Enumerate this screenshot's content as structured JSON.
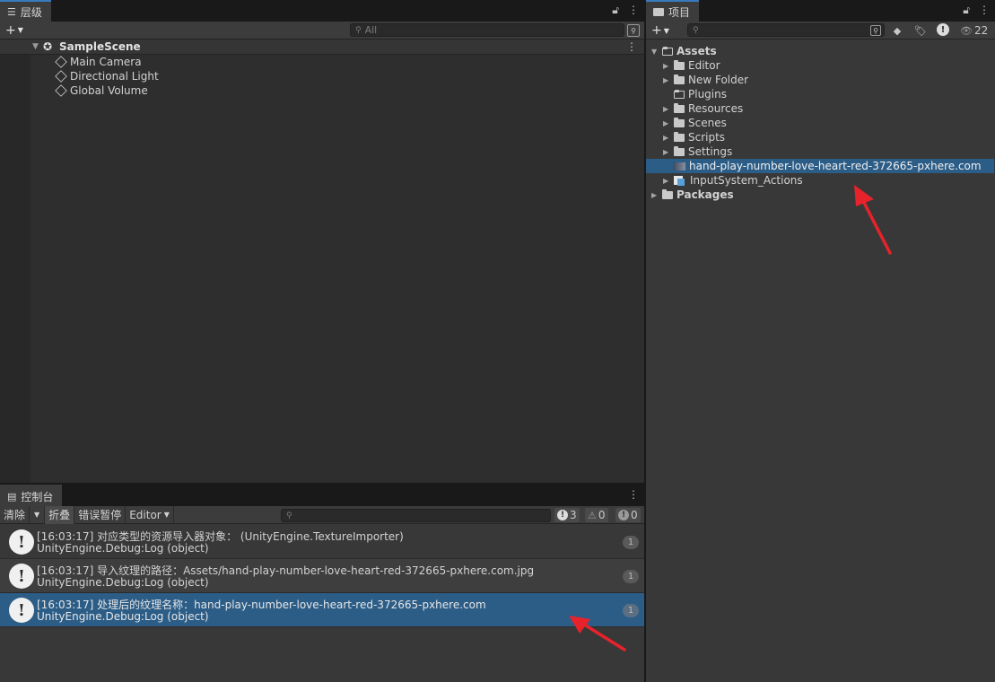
{
  "hierarchy": {
    "tab_label": "层级",
    "search_placeholder": "All",
    "scene_name": "SampleScene",
    "objects": [
      "Main Camera",
      "Directional Light",
      "Global Volume"
    ]
  },
  "project": {
    "tab_label": "项目",
    "hidden_count": "22",
    "tree": [
      {
        "label": "Assets",
        "depth": 0,
        "expanded": true,
        "bold": true,
        "kind": "folder-open"
      },
      {
        "label": "Editor",
        "depth": 1,
        "kind": "folder",
        "arrow": true
      },
      {
        "label": "New Folder",
        "depth": 1,
        "kind": "folder",
        "arrow": true
      },
      {
        "label": "Plugins",
        "depth": 1,
        "kind": "folder-empty",
        "arrow": false
      },
      {
        "label": "Resources",
        "depth": 1,
        "kind": "folder",
        "arrow": true
      },
      {
        "label": "Scenes",
        "depth": 1,
        "kind": "folder",
        "arrow": true
      },
      {
        "label": "Scripts",
        "depth": 1,
        "kind": "folder",
        "arrow": true
      },
      {
        "label": "Settings",
        "depth": 1,
        "kind": "folder",
        "arrow": true
      },
      {
        "label": "hand-play-number-love-heart-red-372665-pxhere.com",
        "depth": 1,
        "kind": "image",
        "selected": true
      },
      {
        "label": "InputSystem_Actions",
        "depth": 1,
        "kind": "input-actions",
        "arrow": true
      },
      {
        "label": "Packages",
        "depth": 0,
        "kind": "folder",
        "bold": true,
        "arrow": true
      }
    ]
  },
  "console": {
    "tab_label": "控制台",
    "buttons": {
      "clear": "清除",
      "collapse": "折叠",
      "error_pause": "错误暂停",
      "editor": "Editor"
    },
    "counts": {
      "info": "3",
      "warning": "0",
      "error": "0"
    },
    "logs": [
      {
        "line1": "[16:03:17] 对应类型的资源导入器对象：  (UnityEngine.TextureImporter)",
        "line2": "UnityEngine.Debug:Log (object)",
        "count": "1"
      },
      {
        "line1": "[16:03:17] 导入纹理的路径：Assets/hand-play-number-love-heart-red-372665-pxhere.com.jpg",
        "line2": "UnityEngine.Debug:Log (object)",
        "count": "1"
      },
      {
        "line1": "[16:03:17] 处理后的纹理名称：hand-play-number-love-heart-red-372665-pxhere.com",
        "line2": "UnityEngine.Debug:Log (object)",
        "count": "1"
      }
    ]
  },
  "colors": {
    "selection": "#2c5d87",
    "annotation_arrow": "#e8222a"
  }
}
